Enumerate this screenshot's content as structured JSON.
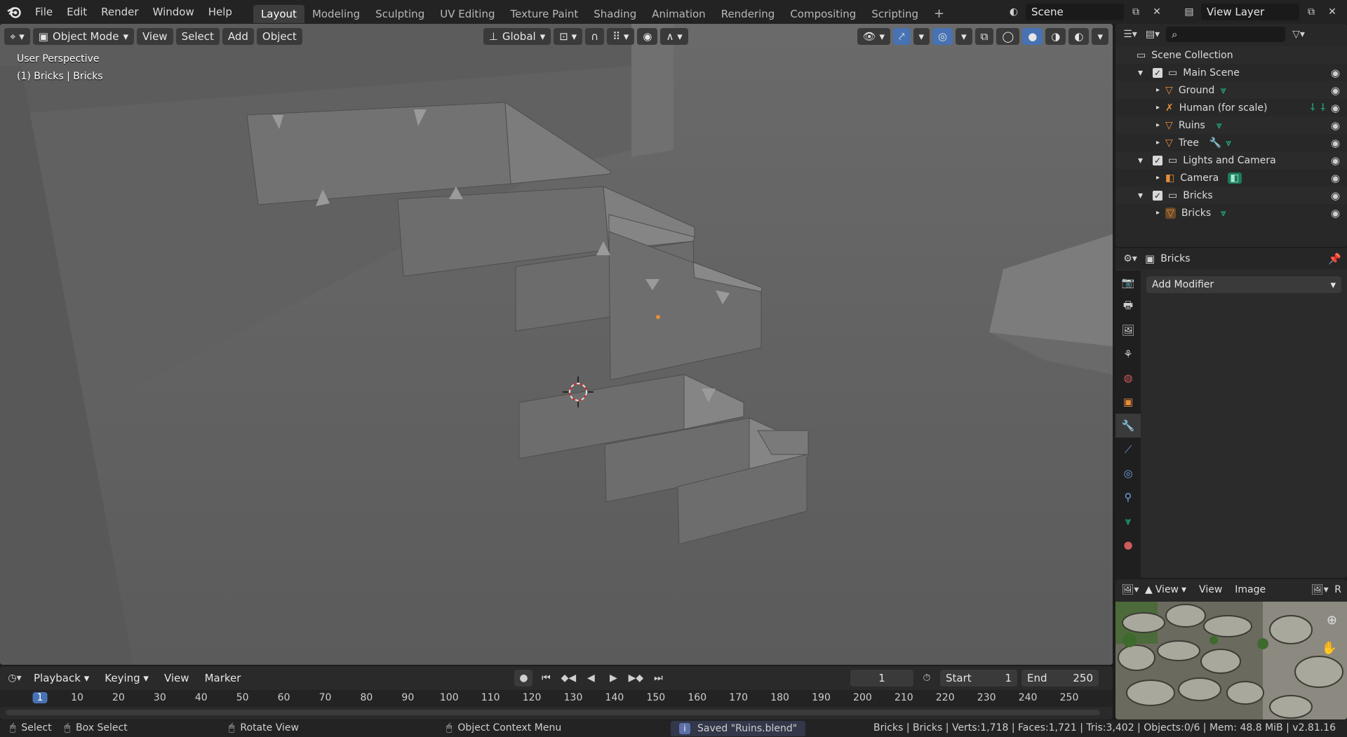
{
  "menu": [
    "File",
    "Edit",
    "Render",
    "Window",
    "Help"
  ],
  "workspaces": [
    "Layout",
    "Modeling",
    "Sculpting",
    "UV Editing",
    "Texture Paint",
    "Shading",
    "Animation",
    "Rendering",
    "Compositing",
    "Scripting"
  ],
  "workspace_add": "+",
  "scene_name": "Scene",
  "view_layer": "View Layer",
  "viewport": {
    "mode": "Object Mode",
    "menus": [
      "View",
      "Select",
      "Add",
      "Object"
    ],
    "orientation": "Global",
    "perspective_label": "User Perspective",
    "object_label": "(1) Bricks | Bricks"
  },
  "outliner": {
    "root": "Scene Collection",
    "rows": [
      {
        "label": "Main Scene",
        "type": "collection"
      },
      {
        "label": "Ground",
        "type": "mesh"
      },
      {
        "label": "Human (for scale)",
        "type": "armature"
      },
      {
        "label": "Ruins",
        "type": "mesh"
      },
      {
        "label": "Tree",
        "type": "mesh"
      },
      {
        "label": "Lights and Camera",
        "type": "collection"
      },
      {
        "label": "Camera",
        "type": "camera"
      },
      {
        "label": "Bricks",
        "type": "collection"
      },
      {
        "label": "Bricks",
        "type": "mesh"
      }
    ]
  },
  "properties": {
    "object_name": "Bricks",
    "add_modifier": "Add Modifier"
  },
  "image_editor": {
    "view_label": "View",
    "menus": [
      "View",
      "Image"
    ],
    "cutoff": "R"
  },
  "timeline": {
    "menus": [
      "Playback",
      "Keying",
      "View",
      "Marker"
    ],
    "current_frame": "1",
    "start_label": "Start",
    "start": "1",
    "end_label": "End",
    "end": "250",
    "ticks": [
      "1",
      "10",
      "20",
      "30",
      "40",
      "50",
      "60",
      "70",
      "80",
      "90",
      "100",
      "110",
      "120",
      "130",
      "140",
      "150",
      "160",
      "170",
      "180",
      "190",
      "200",
      "210",
      "220",
      "230",
      "240",
      "250"
    ]
  },
  "status": {
    "select": "Select",
    "box_select": "Box Select",
    "rotate_view": "Rotate View",
    "context_menu": "Object Context Menu",
    "message": "Saved \"Ruins.blend\"",
    "stats": "Bricks | Bricks | Verts:1,718 | Faces:1,721 | Tris:3,402 | Objects:0/6 | Mem: 48.8 MiB | v2.81.16"
  },
  "colors": {
    "accent": "#4772b3",
    "mesh_green": "#1ec88a",
    "object_orange": "#e88c3a",
    "viewport_bg": "#656565"
  }
}
